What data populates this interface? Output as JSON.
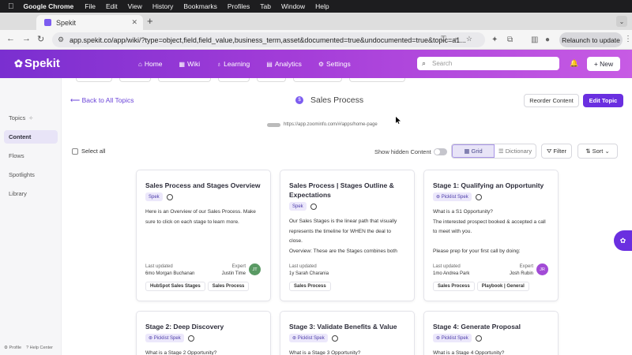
{
  "mac_menu": {
    "app": "Google Chrome",
    "items": [
      "File",
      "Edit",
      "View",
      "History",
      "Bookmarks",
      "Profiles",
      "Tab",
      "Window",
      "Help"
    ]
  },
  "browser": {
    "tab_title": "Spekit",
    "url": "app.spekit.co/app/wiki/?type=object,field,field_value,business_term,asset&documented=true&undocumented=true&topic=a1...",
    "relaunch": "Relaunch to update"
  },
  "header": {
    "logo": "Spekit",
    "nav": [
      "Home",
      "Wiki",
      "Learning",
      "Analytics",
      "Settings"
    ],
    "search_placeholder": "Search",
    "new_label": "New"
  },
  "sidebar": {
    "items": [
      "Topics",
      "Content",
      "Flows",
      "Spotlights",
      "Library"
    ],
    "footer": [
      "Profile",
      "Help Center"
    ]
  },
  "page": {
    "back": "Back to All Topics",
    "topic": "Sales Process",
    "reorder": "Reorder Content",
    "edit": "Edit Topic",
    "source_url": "https://app.zoominfo.com/#/apps/home-page",
    "select_all": "Select all",
    "show_hidden": "Show hidden Content",
    "view_grid": "Grid",
    "view_dictionary": "Dictionary",
    "filter": "Filter",
    "sort": "Sort"
  },
  "meta_labels": {
    "updated": "Last updated",
    "expert": "Expert"
  },
  "cards": [
    {
      "title": "Sales Process and Stages Overview",
      "badge": "Spek",
      "body": [
        "Here is an Overview of our Sales Process. Make",
        "sure to click on each stage to learn more."
      ],
      "updated": "6mo Morgan Buchanan",
      "expert": "Justin Time",
      "avatar": "JT",
      "avatar_color": "#5a9a64",
      "tags": [
        "HubSpot Sales Stages",
        "Sales Process"
      ]
    },
    {
      "title": "Sales Process | Stages Outline & Expectations",
      "badge": "Spek",
      "body": [
        "Our Sales Stages  is the linear path that visually",
        "represents the timeline for WHEN the deal to",
        "close.",
        "Overview: These are the Stages combines both"
      ],
      "updated": "1y Sarah Charania",
      "expert": "",
      "avatar": "",
      "avatar_color": "",
      "tags": [
        "Sales Process"
      ]
    },
    {
      "title": "Stage 1: Qualifying an Opportunity",
      "badge": "Picklist Spek",
      "body": [
        "What is a S1 Opportunity?",
        "The interested prospect booked & accepted a call",
        "to meet with you.",
        "",
        "Please prep for your first call by doing:"
      ],
      "updated": "1mo Andrea Park",
      "expert": "Josh Rubin",
      "avatar": "JR",
      "avatar_color": "#a24bd6",
      "tags": [
        "Sales Process",
        "Playbook | General"
      ]
    },
    {
      "title": "Stage 2: Deep Discovery",
      "badge": "Picklist Spek",
      "body": [
        "What is a Stage 2 Opportunity?"
      ]
    },
    {
      "title": "Stage 3: Validate Benefits & Value",
      "badge": "Picklist Spek",
      "body": [
        "What is a Stage 3 Opportunity?"
      ]
    },
    {
      "title": "Stage 4: Generate Proposal",
      "badge": "Picklist Spek",
      "body": [
        "What is a Stage 4 Opportunity?"
      ]
    }
  ]
}
